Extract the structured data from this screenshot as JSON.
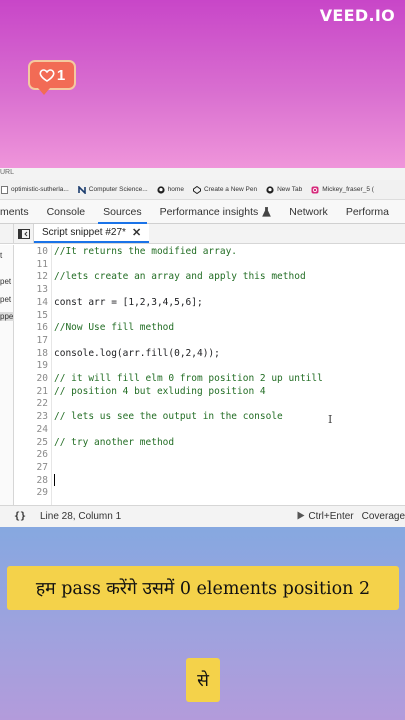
{
  "watermark": "VEED.IO",
  "like_badge": {
    "count": "1",
    "icon": "heart-icon"
  },
  "browser": {
    "url_label": "URL",
    "bookmarks": [
      {
        "label": "optimistic-sutherla...",
        "icon": "page-icon"
      },
      {
        "label": "Computer Science...",
        "icon": "n-logo-icon"
      },
      {
        "label": "home",
        "icon": "github-icon"
      },
      {
        "label": "Create a New Pen",
        "icon": "codepen-icon"
      },
      {
        "label": "New Tab",
        "icon": "github-icon"
      },
      {
        "label": "Mickey_fraser_5 (",
        "icon": "instagram-icon"
      }
    ]
  },
  "devtools": {
    "tabs": [
      {
        "label": "ments",
        "active": false
      },
      {
        "label": "Console",
        "active": false
      },
      {
        "label": "Sources",
        "active": true
      },
      {
        "label": "Performance insights",
        "active": false
      },
      {
        "label": "Network",
        "active": false
      },
      {
        "label": "Performa",
        "active": false
      }
    ],
    "file_tab": "Script snippet #27*",
    "navigator_items": [
      "t",
      "pet",
      "pet",
      "ppe"
    ],
    "code_lines": [
      {
        "n": "10",
        "text": "//It returns the modified array.",
        "comment": true
      },
      {
        "n": "11",
        "text": "",
        "comment": false
      },
      {
        "n": "12",
        "text": "//lets create an array and apply this method",
        "comment": true
      },
      {
        "n": "13",
        "text": "",
        "comment": false
      },
      {
        "n": "14",
        "text": "const arr = [1,2,3,4,5,6];",
        "comment": false
      },
      {
        "n": "15",
        "text": "",
        "comment": false
      },
      {
        "n": "16",
        "text": "//Now Use fill method",
        "comment": true
      },
      {
        "n": "17",
        "text": "",
        "comment": false
      },
      {
        "n": "18",
        "text": "console.log(arr.fill(0,2,4));",
        "comment": false
      },
      {
        "n": "19",
        "text": "",
        "comment": false
      },
      {
        "n": "20",
        "text": "// it will fill elm 0 from position 2 up untill",
        "comment": true
      },
      {
        "n": "21",
        "text": "// position 4 but exluding position 4",
        "comment": true
      },
      {
        "n": "22",
        "text": "",
        "comment": false
      },
      {
        "n": "23",
        "text": "// lets us see the output in the console",
        "comment": true
      },
      {
        "n": "24",
        "text": "",
        "comment": false
      },
      {
        "n": "25",
        "text": "// try another method",
        "comment": true
      },
      {
        "n": "26",
        "text": "",
        "comment": false
      },
      {
        "n": "27",
        "text": "",
        "comment": false
      },
      {
        "n": "28",
        "text": "",
        "comment": false
      },
      {
        "n": "29",
        "text": "",
        "comment": false
      }
    ],
    "status": {
      "braces": "{}",
      "cursor_position": "Line 28, Column 1",
      "run_label": "Ctrl+Enter",
      "coverage_label": "Coverage"
    }
  },
  "captions": {
    "line1": "हम pass करेंगे उसमें 0 elements position 2",
    "line2": "से"
  },
  "colors": {
    "accent": "#1a73e8",
    "comment": "#236e25",
    "caption_bg": "#f4d24a",
    "badge": "#f26b55"
  }
}
